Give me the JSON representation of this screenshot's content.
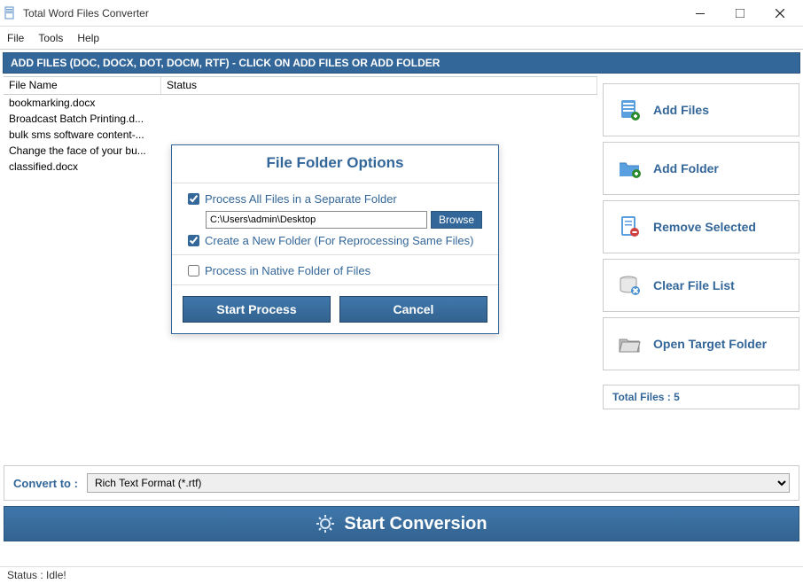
{
  "window": {
    "title": "Total Word Files Converter"
  },
  "menu": {
    "file": "File",
    "tools": "Tools",
    "help": "Help"
  },
  "header_strip": "ADD FILES (DOC, DOCX, DOT, DOCM, RTF) - CLICK ON ADD FILES OR ADD FOLDER",
  "table": {
    "col_filename": "File Name",
    "col_status": "Status",
    "rows": [
      {
        "file": "bookmarking.docx",
        "status": ""
      },
      {
        "file": "Broadcast Batch Printing.d...",
        "status": ""
      },
      {
        "file": "bulk sms software content-...",
        "status": ""
      },
      {
        "file": "Change the face of your bu...",
        "status": ""
      },
      {
        "file": "classified.docx",
        "status": ""
      }
    ]
  },
  "sidebar": {
    "add_files": "Add Files",
    "add_folder": "Add Folder",
    "remove_selected": "Remove Selected",
    "clear_list": "Clear File List",
    "open_target": "Open Target Folder",
    "total_files_label": "Total Files :",
    "total_files_value": "5"
  },
  "convert": {
    "label": "Convert to :",
    "selected": "Rich Text Format (*.rtf)"
  },
  "start_button": "Start Conversion",
  "status": "Status  :  Idle!",
  "modal": {
    "title": "File Folder Options",
    "process_separate_label": "Process All Files in a Separate Folder",
    "process_separate_checked": true,
    "path_value": "C:\\Users\\admin\\Desktop",
    "browse_label": "Browse",
    "create_new_folder_label": "Create a New Folder (For Reprocessing Same Files)",
    "create_new_folder_checked": true,
    "process_native_label": "Process in Native Folder of Files",
    "process_native_checked": false,
    "start_label": "Start Process",
    "cancel_label": "Cancel"
  }
}
